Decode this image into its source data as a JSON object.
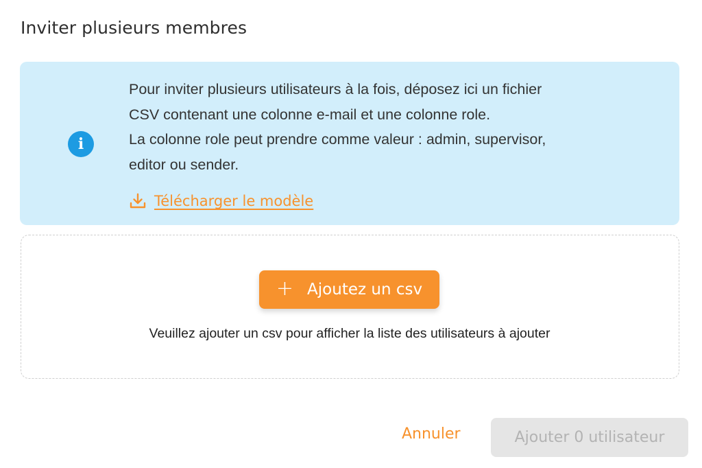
{
  "dialog": {
    "title": "Inviter plusieurs membres"
  },
  "info": {
    "icon": "info-icon",
    "line1": "Pour inviter plusieurs utilisateurs à la fois, déposez ici un fichier",
    "line2": "CSV contenant une colonne e-mail et une colonne role.",
    "line3": "La colonne role peut prendre comme valeur : admin, supervisor,",
    "line4": "editor ou sender.",
    "download_icon": "download-icon",
    "download_label": "Télécharger le modèle"
  },
  "dropzone": {
    "add_icon": "plus-icon",
    "add_button_label": "Ajoutez un csv",
    "hint": "Veuillez ajouter un csv pour afficher la liste des utilisateurs à ajouter"
  },
  "footer": {
    "cancel_label": "Annuler",
    "submit_label": "Ajouter 0 utilisateur",
    "submit_disabled": true
  },
  "colors": {
    "accent": "#f7922d",
    "info_bg": "#d2eefb",
    "info_icon": "#1d9be2",
    "disabled_bg": "#e5e5e5",
    "disabled_text": "#b3b3b3"
  }
}
